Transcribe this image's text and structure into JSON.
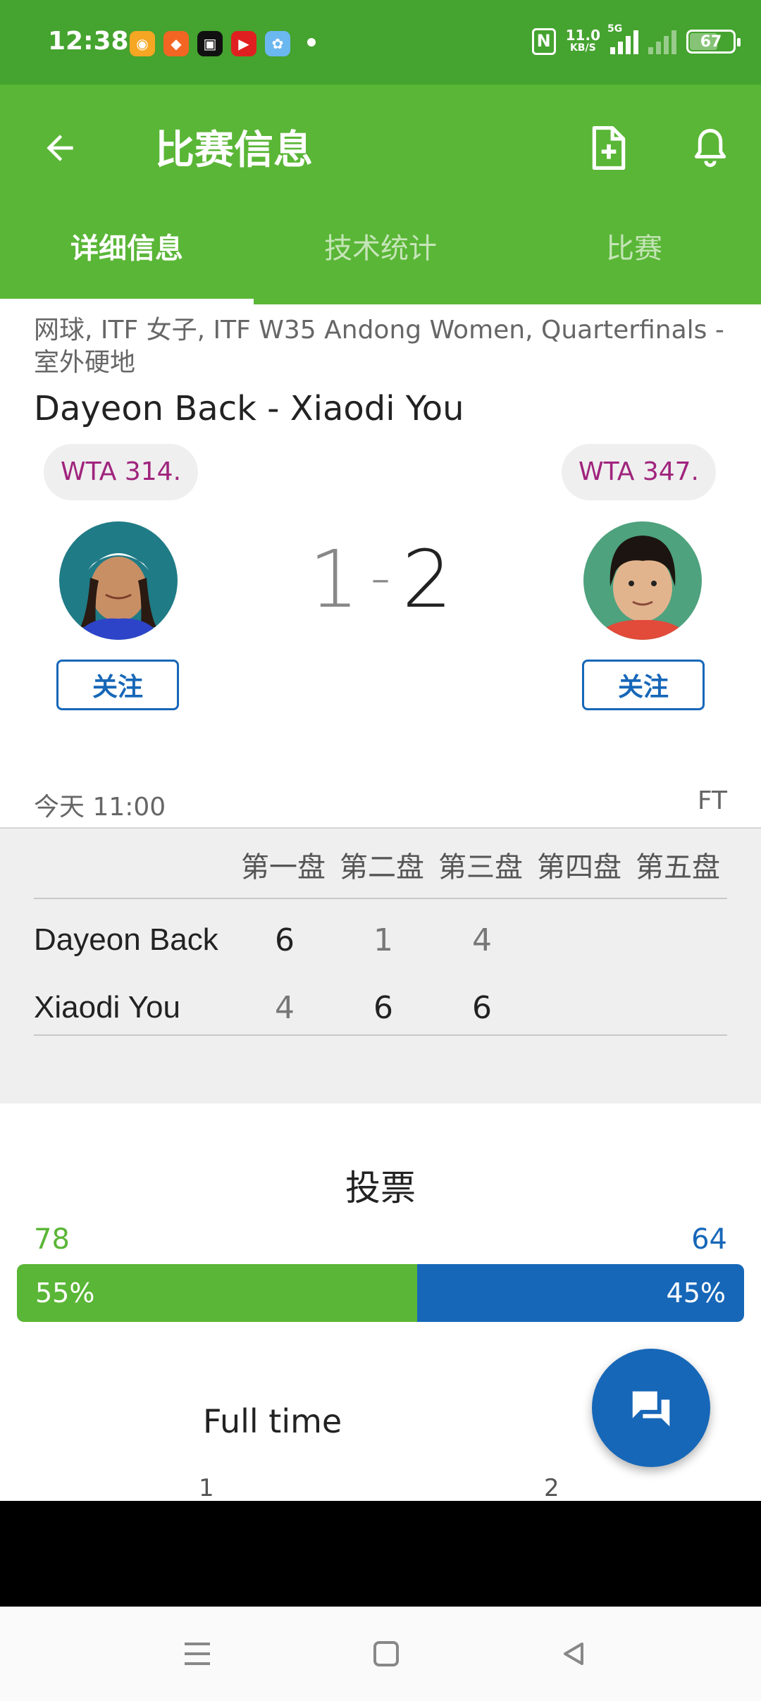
{
  "status_bar": {
    "time": "12:38",
    "net_speed": "11.0",
    "net_speed_unit": "KB/S",
    "network_label": "5G",
    "battery": "67",
    "battery_level": 0.67
  },
  "app_bar": {
    "title": "比赛信息",
    "tabs": [
      {
        "label": "详细信息",
        "active": true
      },
      {
        "label": "技术统计",
        "active": false
      },
      {
        "label": "比赛",
        "active": false
      }
    ]
  },
  "match": {
    "breadcrumb": "网球, ITF 女子, ITF W35 Andong Women, Quarterfinals - 室外硬地",
    "title": "Dayeon Back - Xiaodi You",
    "home": {
      "rank": "WTA 314.",
      "follow_label": "关注",
      "sets_won": "1"
    },
    "away": {
      "rank": "WTA 347.",
      "follow_label": "关注",
      "sets_won": "2"
    },
    "score_separator": "-",
    "start_time": "今天 11:00",
    "status": "FT"
  },
  "sets_table": {
    "headers": [
      "第一盘",
      "第二盘",
      "第三盘",
      "第四盘",
      "第五盘"
    ],
    "rows": [
      {
        "player": "Dayeon Back",
        "scores": [
          "6",
          "1",
          "4"
        ]
      },
      {
        "player": "Xiaodi You",
        "scores": [
          "4",
          "6",
          "6"
        ]
      }
    ]
  },
  "poll": {
    "title": "投票",
    "home_votes": "78",
    "away_votes": "64",
    "home_percent": "55%",
    "away_percent": "45%",
    "home_share": 0.55
  },
  "full_time": {
    "title": "Full time",
    "labels": [
      "1",
      "2"
    ]
  },
  "colors": {
    "status_bar": "#45a32f",
    "app_bar": "#5ab636",
    "home_accent": "#5ab636",
    "away_accent": "#1767b8",
    "rank_text": "#a0247d"
  },
  "icons": {
    "back": "arrow-left",
    "add_calendar": "file-plus",
    "notifications": "bell",
    "chat": "chat-bubbles"
  }
}
